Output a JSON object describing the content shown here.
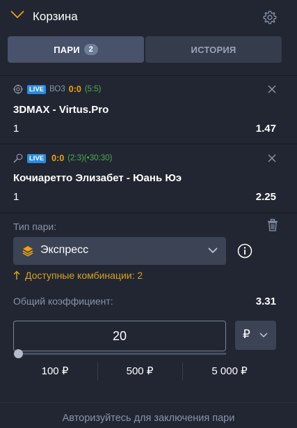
{
  "header": {
    "title": "Корзина",
    "chevron_icon": "chevron-down-icon",
    "settings_icon": "gear-icon"
  },
  "tabs": [
    {
      "label": "ПАРИ",
      "badge": "2",
      "active": true
    },
    {
      "label": "ИСТОРИЯ",
      "active": false
    }
  ],
  "bets": [
    {
      "sport_icon": "esports-target-icon",
      "live": "LIVE",
      "format": "ВО3",
      "score": "0:0",
      "extra": "(5:5)",
      "match": "3DMAX - Virtus.Pro",
      "outcome": "1",
      "odds": "1.47"
    },
    {
      "sport_icon": "tennis-racket-icon",
      "live": "LIVE",
      "format": "",
      "score": "0:0",
      "extra": "(2:3)(•30:30)",
      "match": "Кочиаретто Элизабет - Юань Юэ",
      "outcome": "1",
      "odds": "2.25"
    }
  ],
  "bet_type": {
    "label": "Тип пари:",
    "selected": "Экспресс",
    "combinations": "Доступные комбинации: 2"
  },
  "total": {
    "label": "Общий коэффициент:",
    "value": "3.31"
  },
  "stake": {
    "value": "20",
    "currency": "₽",
    "slider_fraction": 0.0
  },
  "quick_amounts": [
    "100 ₽",
    "500 ₽",
    "5 000 ₽"
  ],
  "login_hint": "Авторизуйтесь для заключения пари",
  "colors": {
    "background": "#212632",
    "tab_active": "#48526a",
    "tab_inactive": "#353c4c",
    "live": "#2a8ce0",
    "score": "#f2a20b",
    "sub_score": "#4db050",
    "combinations": "#d9a21b",
    "muted": "#8a94a8"
  }
}
